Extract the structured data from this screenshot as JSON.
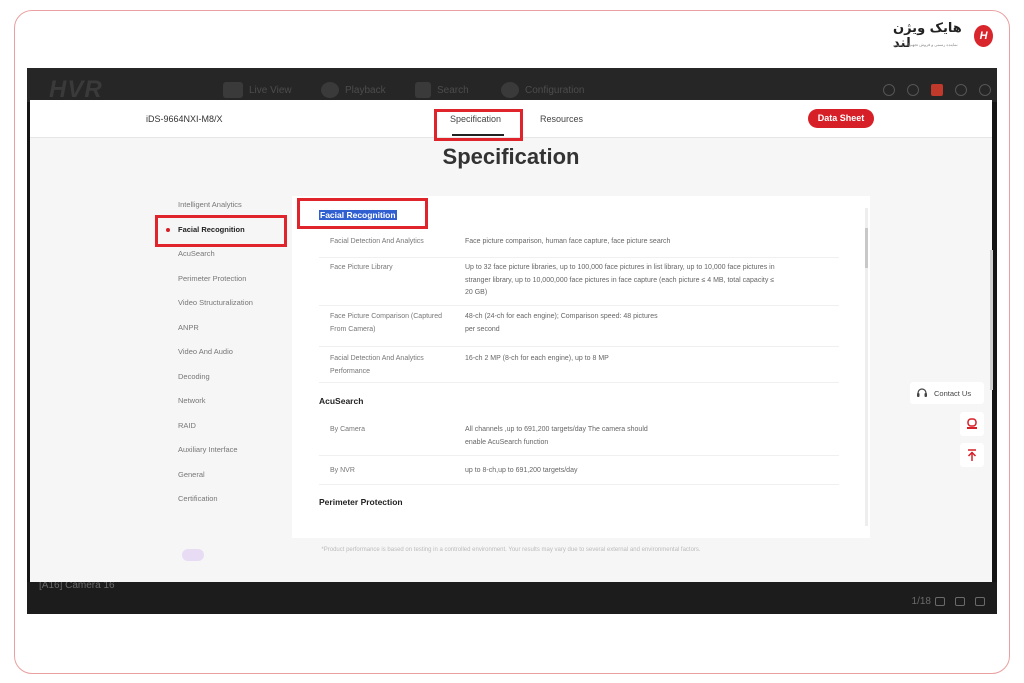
{
  "brand": {
    "name": "هایک ویژن لند",
    "tagline": "نماینده رسمی و فروش تجهیزات امنیتی",
    "mark": "H"
  },
  "nvr": {
    "logo": "HVR",
    "nav": [
      "Live View",
      "Playback",
      "Search",
      "Configuration"
    ],
    "camera_label": "[A16] Camera 16",
    "pager": "1/18"
  },
  "header": {
    "model": "iDS-9664NXI-M8/X",
    "tabs": [
      "Specification",
      "Resources"
    ],
    "active_tab": "Specification",
    "datasheet_label": "Data Sheet"
  },
  "page_title": "Specification",
  "sidenav": [
    "Intelligent Analytics",
    "Facial Recognition",
    "AcuSearch",
    "Perimeter Protection",
    "Video Structuralization",
    "ANPR",
    "Video And Audio",
    "Decoding",
    "Network",
    "RAID",
    "Auxiliary Interface",
    "General",
    "Certification"
  ],
  "sidenav_active": "Facial Recognition",
  "sections": {
    "facial": {
      "title": "Facial Recognition",
      "rows": [
        {
          "label": "Facial Detection And Analytics",
          "value": "Face picture comparison, human face capture, face picture search"
        },
        {
          "label": "Face Picture Library",
          "value": "Up to 32 face picture libraries, up to 100,000 face pictures in list library, up to 10,000 face pictures in stranger library, up to 10,000,000 face pictures in face capture (each picture ≤ 4 MB, total capacity ≤ 20 GB)"
        },
        {
          "label": "Face Picture Comparison (Captured From Camera)",
          "value": "48-ch (24-ch for each engine); Comparison speed: 48 pictures per second"
        },
        {
          "label": "Facial Detection And Analytics Performance",
          "value": "16-ch 2 MP (8-ch for each engine), up to 8 MP"
        }
      ]
    },
    "acusearch": {
      "title": "AcuSearch",
      "rows": [
        {
          "label": "By Camera",
          "value": "All channels ,up to 691,200 targets/day The camera should enable AcuSearch function"
        },
        {
          "label": "By NVR",
          "value": "up to 8-ch,up to 691,200 targets/day"
        }
      ]
    },
    "perimeter": {
      "title": "Perimeter Protection"
    }
  },
  "footnote": "*Product performance is based on testing in a controlled environment. Your results may vary due to several external and environmental factors.",
  "contact_label": "Contact Us"
}
